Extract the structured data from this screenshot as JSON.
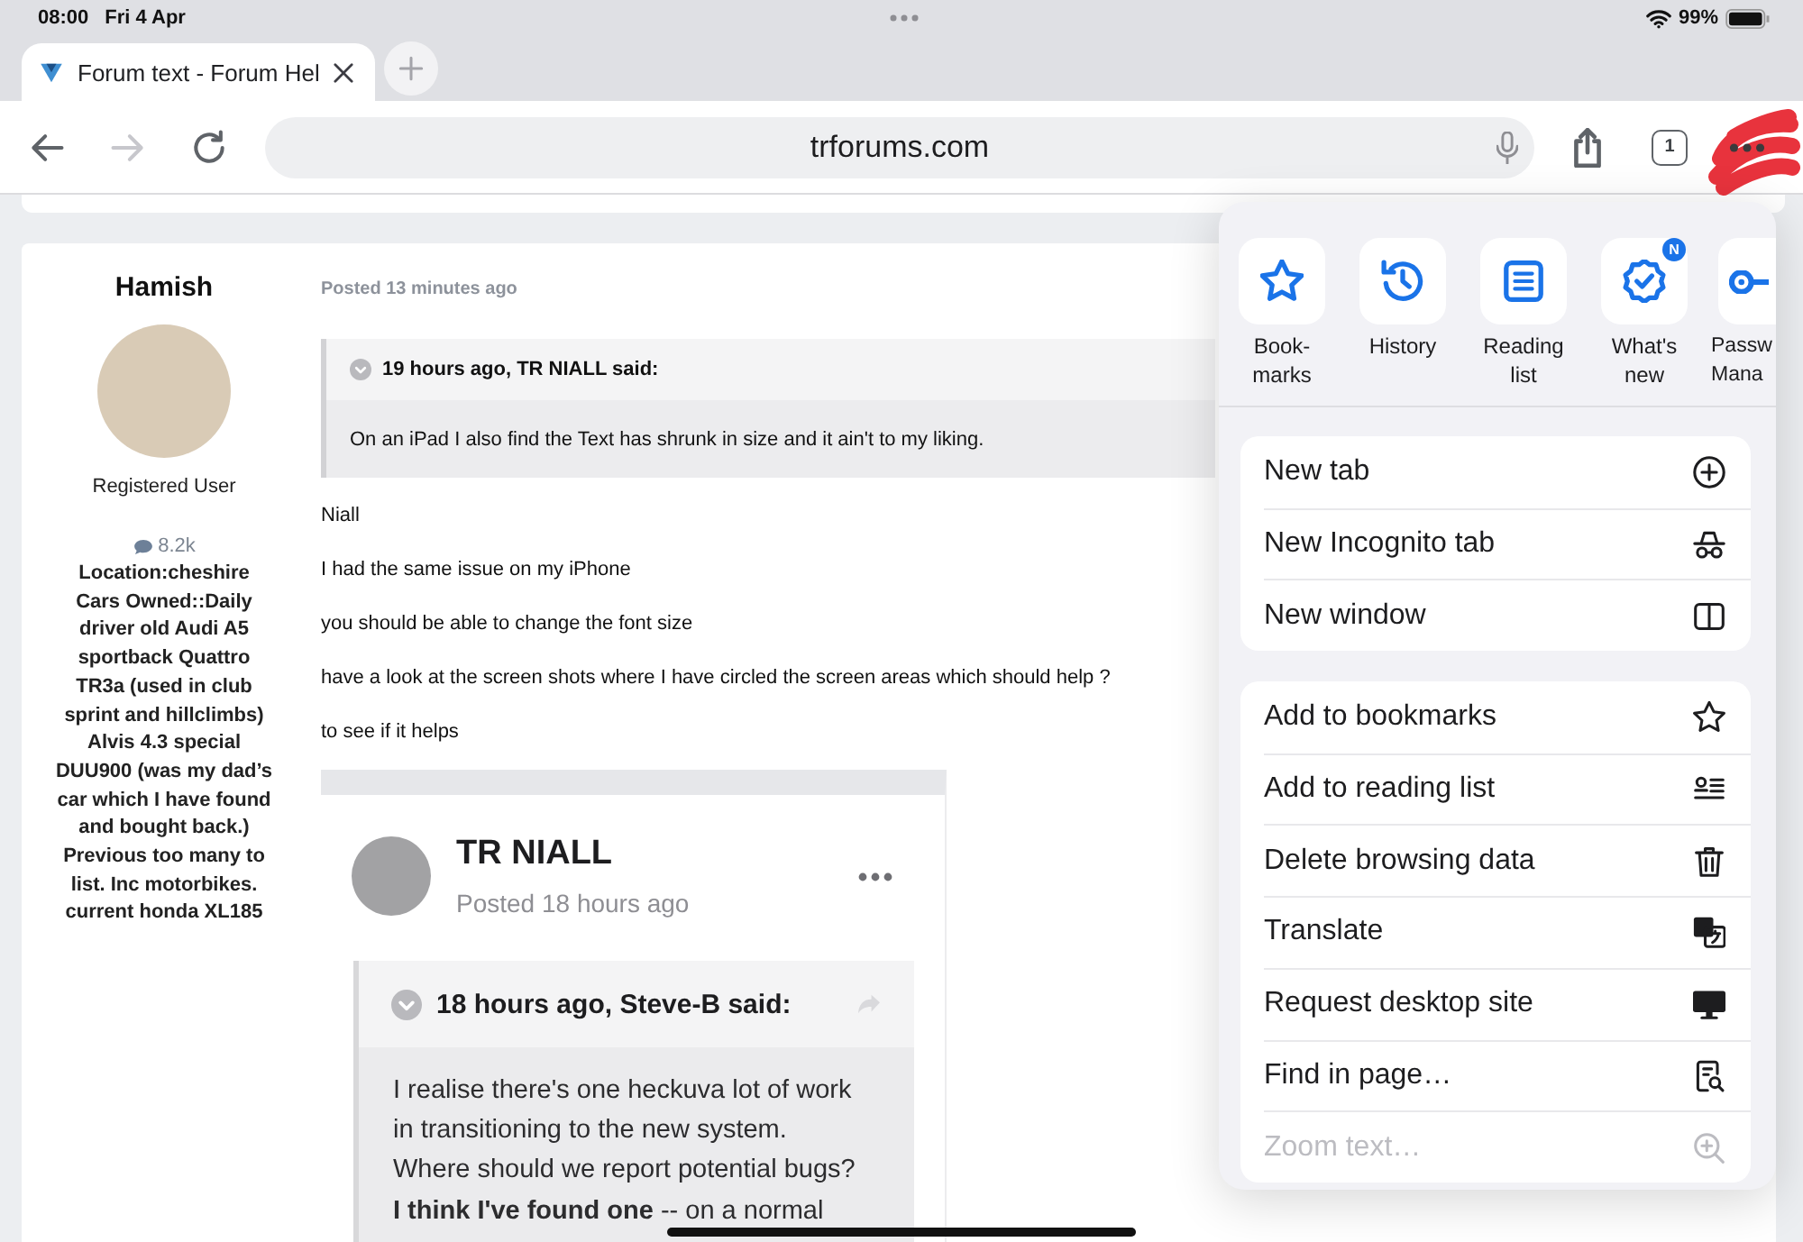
{
  "status_bar": {
    "time": "08:00",
    "date": "Fri 4 Apr",
    "battery": "99%"
  },
  "tabs": [
    {
      "title": "Forum text - Forum Hel"
    }
  ],
  "toolbar": {
    "nav_buttons": [
      {
        "kind": "back",
        "disabled": false
      },
      {
        "kind": "forward",
        "disabled": true
      },
      {
        "kind": "reload",
        "disabled": false
      }
    ],
    "address": "trforums.com",
    "tab_count": "1"
  },
  "post": {
    "author": {
      "name": "Hamish",
      "role": "Registered User",
      "post_count": "8.2k",
      "bio": "Location:cheshire\nCars Owned::Daily\ndriver old Audi A5\nsportback Quattro\nTR3a (used in club\nsprint and hillclimbs)\nAlvis 4.3 special\nDUU900 (was my dad’s\ncar which I have found\nand bought back.)\nPrevious too many to\nlist. Inc motorbikes.\ncurrent honda XL185"
    },
    "posted": "Posted 13 minutes ago",
    "quote": {
      "header": "19 hours ago, TR NIALL said:",
      "body": "On an iPad I also find the Text has shrunk in size and it ain't to my liking."
    },
    "paragraphs": [
      "Niall",
      "I had the same issue on my iPhone",
      "you should be able to change the font size",
      "have a look at the screen shots where I have circled the screen areas which should help ?",
      "to see if it helps"
    ],
    "attached_screenshot": {
      "author": "TR NIALL",
      "posted": "Posted 18 hours ago",
      "quote": {
        "header": "18 hours ago, Steve-B said:",
        "body": "I realise there's one heckuva lot of work\nin transitioning to the new system.\nWhere should we report potential bugs?",
        "reply": "**I think I've found one** -- on a normal"
      }
    }
  },
  "menu": {
    "shortcuts": [
      {
        "label": "Book-\nmarks"
      },
      {
        "label": "History"
      },
      {
        "label": "Reading\nlist"
      },
      {
        "label": "What's\nnew",
        "badge": "N"
      },
      {
        "label": "Passw\nMana"
      }
    ],
    "groups": [
      {
        "items": [
          {
            "label": "New tab",
            "disabled": false
          },
          {
            "label": "New Incognito tab",
            "disabled": false
          },
          {
            "label": "New window",
            "disabled": false
          }
        ]
      },
      {
        "items": [
          {
            "label": "Add to bookmarks",
            "disabled": false
          },
          {
            "label": "Add to reading list",
            "disabled": false
          },
          {
            "label": "Delete browsing data",
            "disabled": false
          },
          {
            "label": "Translate",
            "disabled": false
          },
          {
            "label": "Request desktop site",
            "disabled": false
          },
          {
            "label": "Find in page…",
            "disabled": false
          },
          {
            "label": "Zoom text…",
            "disabled": true
          }
        ]
      }
    ]
  }
}
